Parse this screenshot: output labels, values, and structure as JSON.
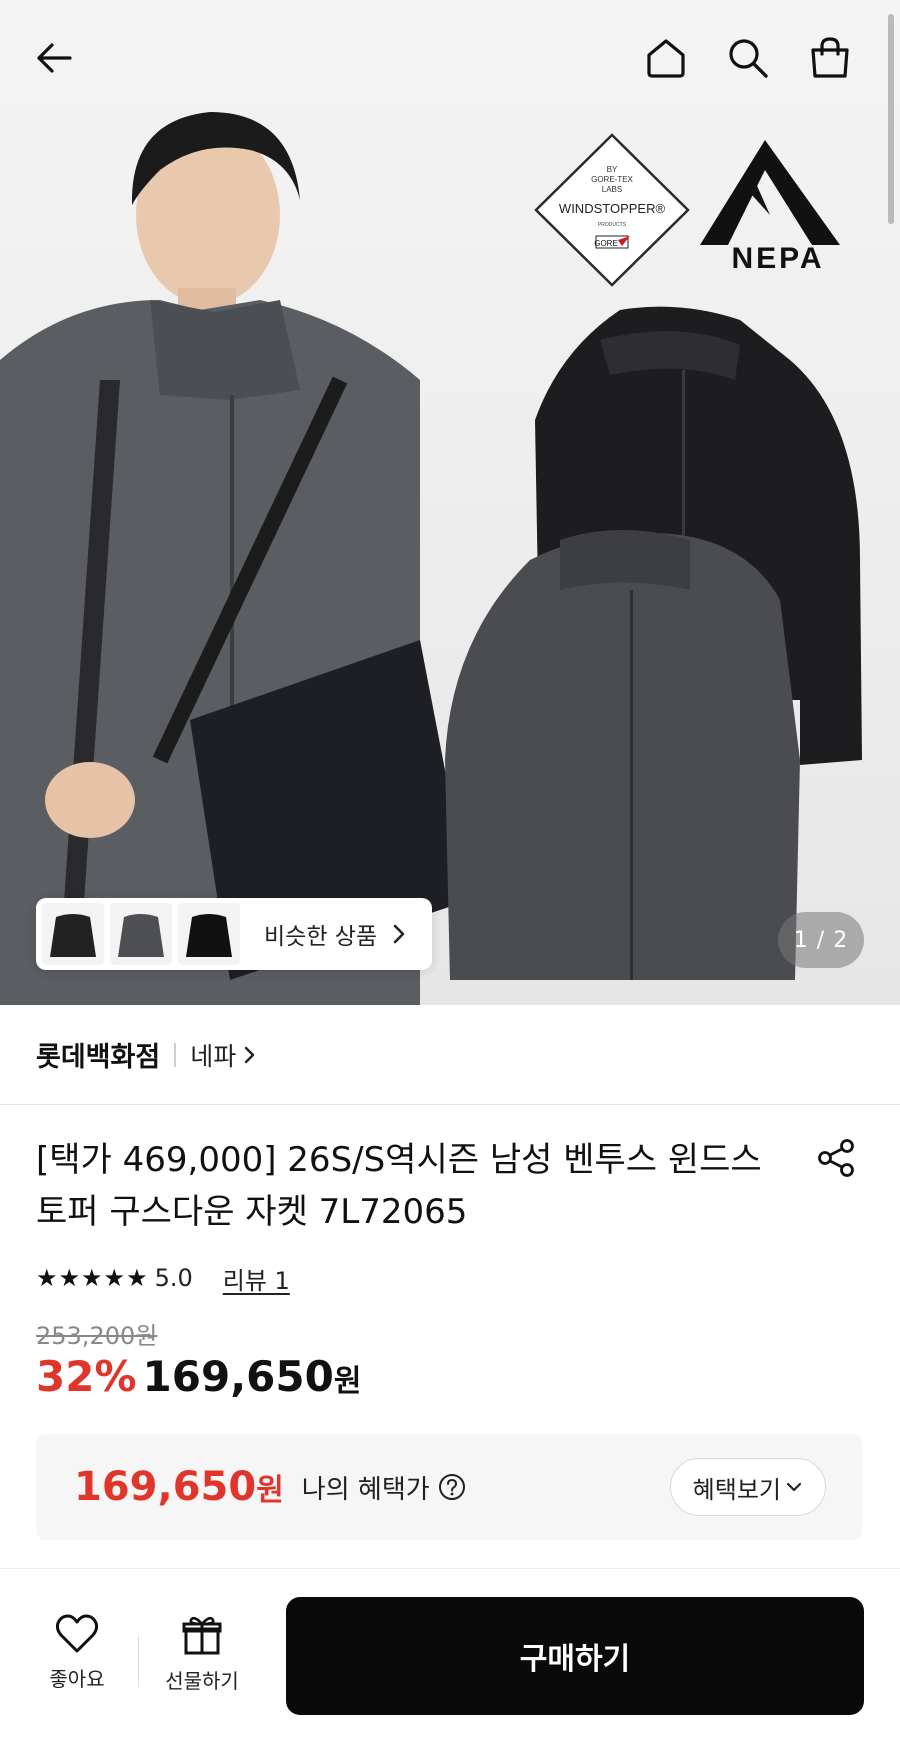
{
  "topbar": {
    "back_icon": "arrow-left-icon",
    "home_icon": "home-icon",
    "search_icon": "search-icon",
    "bag_icon": "shopping-bag-icon"
  },
  "hero": {
    "badge_line1": "BY",
    "badge_line2": "GORE-TEX",
    "badge_line3": "LABS",
    "badge_main": "WINDSTOPPER®",
    "badge_sub": "PRODUCTS",
    "badge_gore": "GORE",
    "brand_logo_text": "NEPA",
    "similar_label": "비슷한 상품",
    "pager_text": "1 / 2"
  },
  "store": {
    "name": "롯데백화점",
    "brand": "네파"
  },
  "product": {
    "title": "[택가 469,000] 26S/S역시즌 남성 벤투스 윈드스토퍼 구스다운 자켓 7L72065",
    "stars": "★★★★★",
    "rating": "5.0",
    "reviews": "리뷰 1",
    "original_price": "253,200원",
    "discount": "32%",
    "price": "169,650",
    "currency": "원"
  },
  "benefit": {
    "price": "169,650",
    "currency": "원",
    "label": "나의 혜택가",
    "button_label": "혜택보기"
  },
  "bottom": {
    "like_label": "좋아요",
    "gift_label": "선물하기",
    "buy_label": "구매하기"
  },
  "colors": {
    "accent_red": "#e0352b",
    "buy_button": "#0a0a0a"
  }
}
